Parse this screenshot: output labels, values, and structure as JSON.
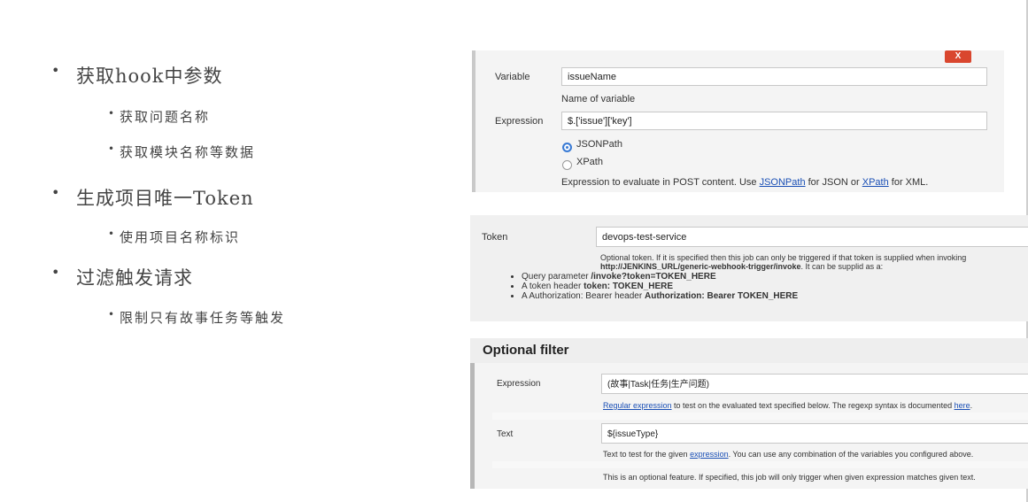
{
  "bullets": {
    "item1": "获取hook中参数",
    "item1_sub1": "获取问题名称",
    "item1_sub2": "获取模块名称等数据",
    "item2": "生成项目唯一Token",
    "item2_sub1": "使用项目名称标识",
    "item3": "过滤触发请求",
    "item3_sub1": "限制只有故事任务等触发"
  },
  "variable_panel": {
    "delete_label": "X",
    "variable_label": "Variable",
    "variable_value": "issueName",
    "variable_help": "Name of variable",
    "expression_label": "Expression",
    "expression_value": "$.['issue']['key']",
    "radio_jsonpath": "JSONPath",
    "radio_xpath": "XPath",
    "radio_selected": "JSONPath",
    "help_prefix": "Expression to evaluate in POST content. Use ",
    "help_link1": "JSONPath",
    "help_mid": " for JSON or ",
    "help_link2": "XPath",
    "help_suffix": " for XML."
  },
  "token_panel": {
    "token_label": "Token",
    "token_value": "devops-test-service",
    "help_line1": "Optional token. If it is specified then this job can only be triggered if that token is supplied when invoking",
    "help_line2_url": "http://JENKINS_URL/generic-webhook-trigger/invoke",
    "help_line2_suffix": ". It can be supplid as a:",
    "list": [
      {
        "prefix": "Query parameter ",
        "bold": "/invoke?token=TOKEN_HERE"
      },
      {
        "prefix": "A token header ",
        "bold": "token: TOKEN_HERE"
      },
      {
        "prefix": "A Authorization: Bearer header ",
        "bold": "Authorization: Bearer TOKEN_HERE"
      }
    ]
  },
  "filter_panel": {
    "heading": "Optional filter",
    "expression_label": "Expression",
    "expression_value": "(故事|Task|任务|生产问题)",
    "expr_help_link": "Regular expression",
    "expr_help_mid": " to test on the evaluated text specified below. The regexp syntax is documented ",
    "expr_help_link2": "here",
    "expr_help_suffix": ".",
    "text_label": "Text",
    "text_value": "${issueType}",
    "text_help_prefix": "Text to test for the given ",
    "text_help_link": "expression",
    "text_help_suffix": ". You can use any combination of the variables you configured above.",
    "footer_note": "This is an optional feature. If specified, this job will only trigger when given expression matches given text."
  }
}
